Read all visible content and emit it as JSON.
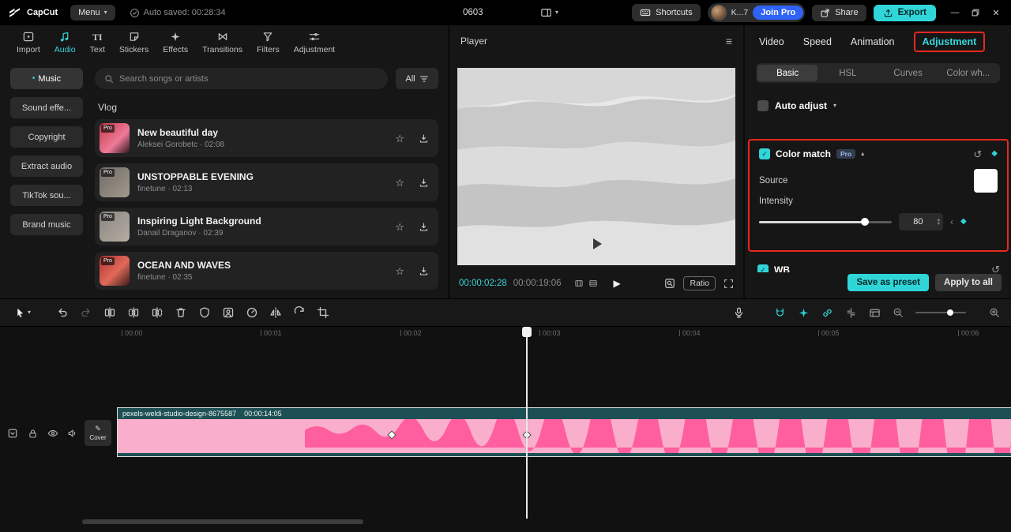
{
  "titlebar": {
    "app_name": "CapCut",
    "menu_label": "Menu",
    "autosave_text": "Auto saved: 00:28:34",
    "project_title": "0603",
    "shortcuts_label": "Shortcuts",
    "user_label": "K...7",
    "join_pro_label": "Join Pro",
    "share_label": "Share",
    "export_label": "Export"
  },
  "media_panel": {
    "tabs": [
      {
        "label": "Import"
      },
      {
        "label": "Audio"
      },
      {
        "label": "Text"
      },
      {
        "label": "Stickers"
      },
      {
        "label": "Effects"
      },
      {
        "label": "Transitions"
      },
      {
        "label": "Filters"
      },
      {
        "label": "Adjustment"
      }
    ],
    "active_tab": "Audio",
    "sidebar_items": [
      {
        "label": "Music"
      },
      {
        "label": "Sound effe..."
      },
      {
        "label": "Copyright"
      },
      {
        "label": "Extract audio"
      },
      {
        "label": "TikTok sou..."
      },
      {
        "label": "Brand music"
      }
    ],
    "search_placeholder": "Search songs or artists",
    "filter_label": "All",
    "section_title": "Vlog",
    "songs": [
      {
        "title": "New beautiful day",
        "artist": "Aleksei Gorobetc · 02:08",
        "badge": "Pro"
      },
      {
        "title": "UNSTOPPABLE EVENING",
        "artist": "finetune · 02:13",
        "badge": "Pro"
      },
      {
        "title": "Inspiring Light Background",
        "artist": "Danail Draganov · 02:39",
        "badge": "Pro"
      },
      {
        "title": "OCEAN AND WAVES",
        "artist": "finetune · 02:35",
        "badge": "Pro"
      }
    ]
  },
  "player": {
    "title": "Player",
    "current_time": "00:00:02:28",
    "total_time": "00:00:19:06",
    "ratio_label": "Ratio"
  },
  "adjust_panel": {
    "tabs": [
      "Video",
      "Speed",
      "Animation",
      "Adjustment"
    ],
    "active_tab": "Adjustment",
    "subtabs": [
      "Basic",
      "HSL",
      "Curves",
      "Color wh..."
    ],
    "active_subtab": "Basic",
    "auto_adjust_label": "Auto adjust",
    "color_match_label": "Color match",
    "pro_badge": "Pro",
    "source_label": "Source",
    "intensity_label": "Intensity",
    "intensity_value": "80",
    "intensity_percent": 80,
    "partial_section_label": "WB",
    "save_preset_label": "Save as preset",
    "apply_all_label": "Apply to all"
  },
  "timeline": {
    "ruler_labels": [
      "00:00",
      "00:01",
      "00:02",
      "00:03",
      "00:04",
      "00:05",
      "00:06"
    ],
    "cover_label": "Cover",
    "clip_name": "pexels-weldi-studio-design-8675587",
    "clip_duration": "00:00:14:05"
  },
  "glyphs": {
    "caret_down": "▾",
    "caret_up": "▴",
    "check": "✓",
    "reset": "↺",
    "diamond": "◆",
    "chevron_left": "‹",
    "play": "▶",
    "star": "☆",
    "bullet": "•",
    "pencil": "✎",
    "hamburger": "≡",
    "minimize": "—",
    "close": "✕",
    "text_tab_icon": "TI"
  },
  "colors": {
    "accent_cyan": "#30d5d8",
    "join_pro_blue": "#2f62f6",
    "annotation_red": "#e8281e",
    "clip_pink": "#f9aecb",
    "clip_wave_pink": "#ff5e9f",
    "clip_teal": "#1d5054"
  }
}
